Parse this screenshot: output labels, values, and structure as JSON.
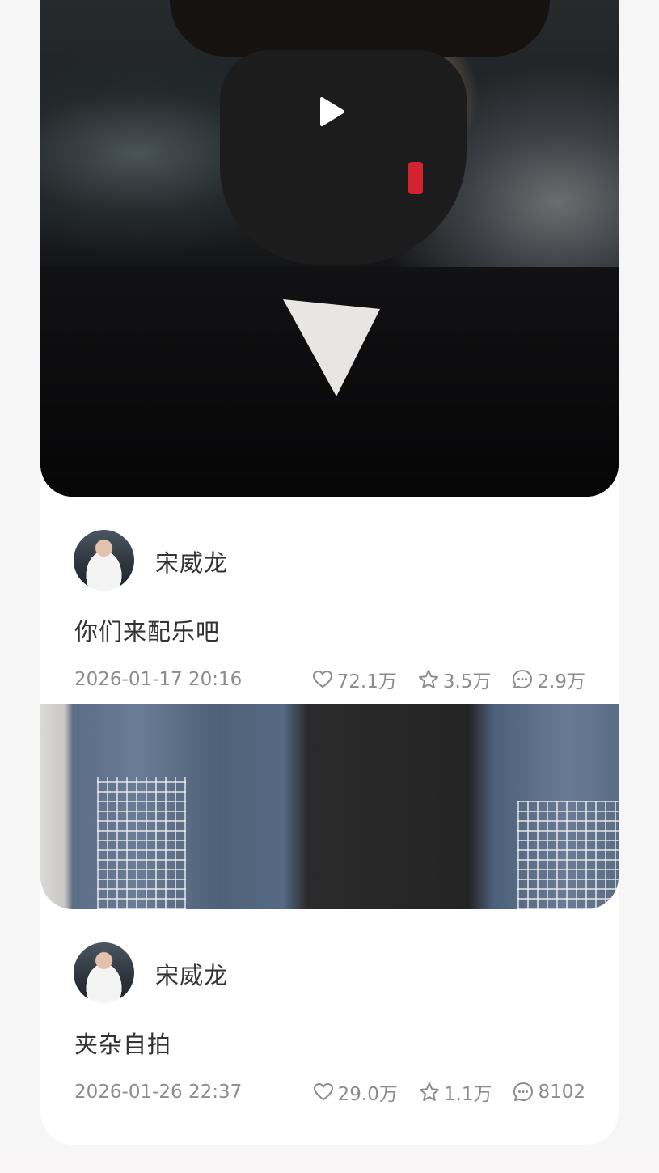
{
  "posts": [
    {
      "author": "宋威龙",
      "caption": "你们来配乐吧",
      "date": "2026-01-17 20:16",
      "likes": "72.1万",
      "favorites": "3.5万",
      "comments": "2.9万",
      "media_type": "video"
    },
    {
      "author": "宋威龙",
      "caption": "夹杂自拍",
      "date": "2026-01-26 22:37",
      "likes": "29.0万",
      "favorites": "1.1万",
      "comments": "8102",
      "media_type": "image"
    }
  ],
  "colors": {
    "text_primary": "#333333",
    "text_secondary": "#8c8c8c",
    "card_bg": "#ffffff",
    "page_bg": "#f7f6f6"
  },
  "icons": [
    "play-icon",
    "heart-icon",
    "star-icon",
    "comment-icon"
  ]
}
